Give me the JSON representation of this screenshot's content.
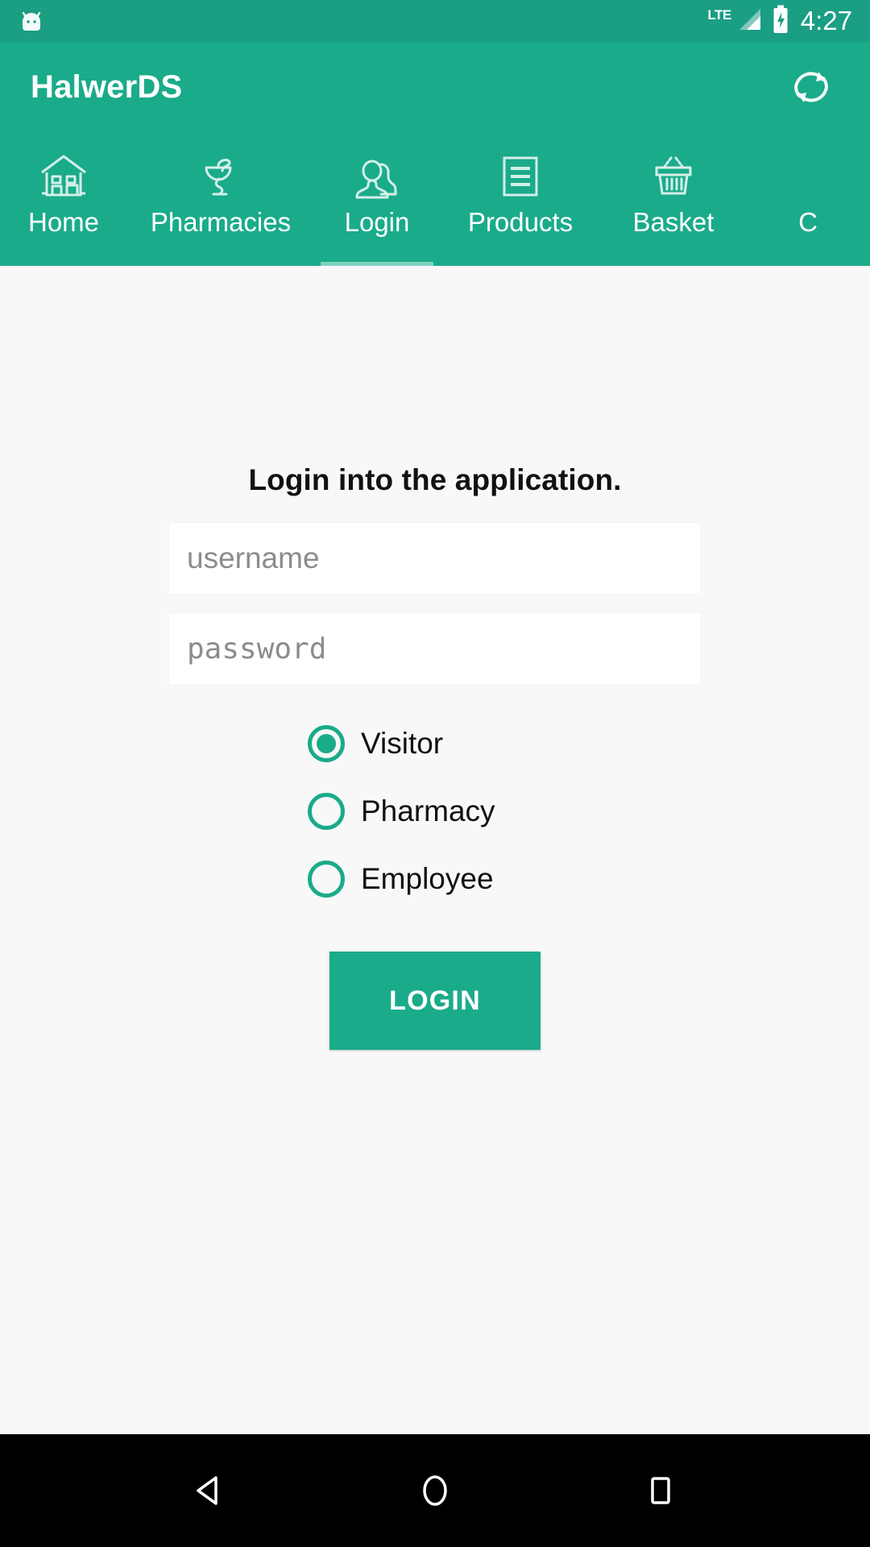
{
  "status_bar": {
    "android_icon": "android-head-icon",
    "network_label": "LTE",
    "signal_icon": "signal-bars-icon",
    "battery_icon": "battery-charging-icon",
    "time": "4:27",
    "background_color": "#1a9e84"
  },
  "app_bar": {
    "title": "HalwerDS",
    "refresh_icon": "refresh-icon",
    "background_color": "#1aab8a"
  },
  "tabs": {
    "active_index": 2,
    "items": [
      {
        "label": "Home",
        "icon": "house-icon"
      },
      {
        "label": "Pharmacies",
        "icon": "bowl-of-hygieia-icon"
      },
      {
        "label": "Login",
        "icon": "two-people-icon"
      },
      {
        "label": "Products",
        "icon": "list-document-icon"
      },
      {
        "label": "Basket",
        "icon": "shopping-basket-icon"
      },
      {
        "label": "C",
        "icon": "partial-tab-icon"
      }
    ]
  },
  "form": {
    "heading": "Login into the application.",
    "username": {
      "value": "",
      "placeholder": "username"
    },
    "password": {
      "value": "",
      "placeholder": "password"
    },
    "roles": [
      {
        "label": "Visitor",
        "selected": true
      },
      {
        "label": "Pharmacy",
        "selected": false
      },
      {
        "label": "Employee",
        "selected": false
      }
    ],
    "submit_label": "LOGIN"
  },
  "nav_bar": {
    "back_icon": "back-triangle-icon",
    "home_icon": "home-circle-icon",
    "recents_icon": "recents-square-icon",
    "background_color": "#000000"
  },
  "colors": {
    "primary": "#1aab8a",
    "primary_dark": "#1a9e84",
    "page_background": "#f8f8f8",
    "field_background": "#ffffff"
  }
}
